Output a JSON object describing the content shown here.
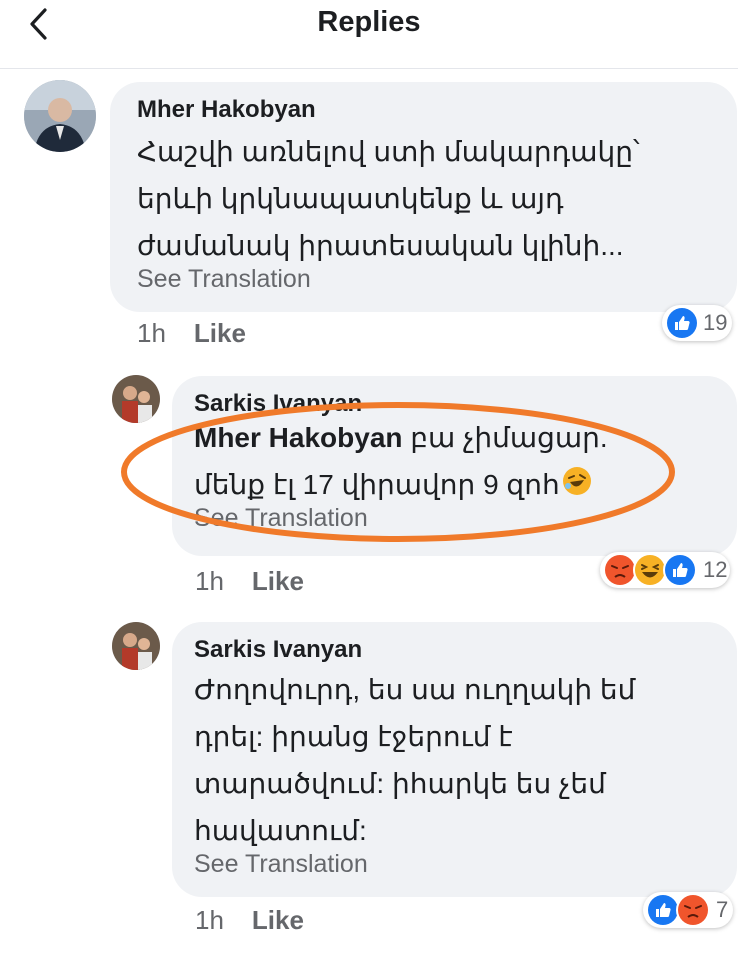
{
  "header": {
    "title": "Replies",
    "back_icon": "chevron-left-icon"
  },
  "comments": [
    {
      "author": "Mher Hakobyan",
      "text": "Հաշվի առնելով ստի մակարդակը՝ երևի կրկնապատկենք և այդ ժամանակ իրատեսական կլինի...",
      "see_translation": "See Translation",
      "time": "1h",
      "like": "Like",
      "reactions": {
        "icons": [
          "like"
        ],
        "count": "19"
      }
    },
    {
      "author": "Sarkis Ivanyan",
      "mention": "Mher Hakobyan",
      "text": "բա չիմացար. մենք էլ 17 վիրավոր 9 զոհ",
      "emoji": "rofl",
      "see_translation": "See Translation",
      "time": "1h",
      "like": "Like",
      "reactions": {
        "icons": [
          "angry",
          "haha",
          "like"
        ],
        "count": "12"
      }
    },
    {
      "author": "Sarkis Ivanyan",
      "text": "Ժողովուրդ, ես սա ուղղակի եմ դրել: իրանց էջերում է տարածվում: իհարկե ես չեմ հավատում:",
      "see_translation": "See Translation",
      "time": "1h",
      "like": "Like",
      "reactions": {
        "icons": [
          "like",
          "angry"
        ],
        "count": "7"
      }
    }
  ],
  "colors": {
    "like": "#1877f2",
    "angry": "#f0552c",
    "haha": "#f7b125",
    "highlight": "#f07a2a"
  }
}
